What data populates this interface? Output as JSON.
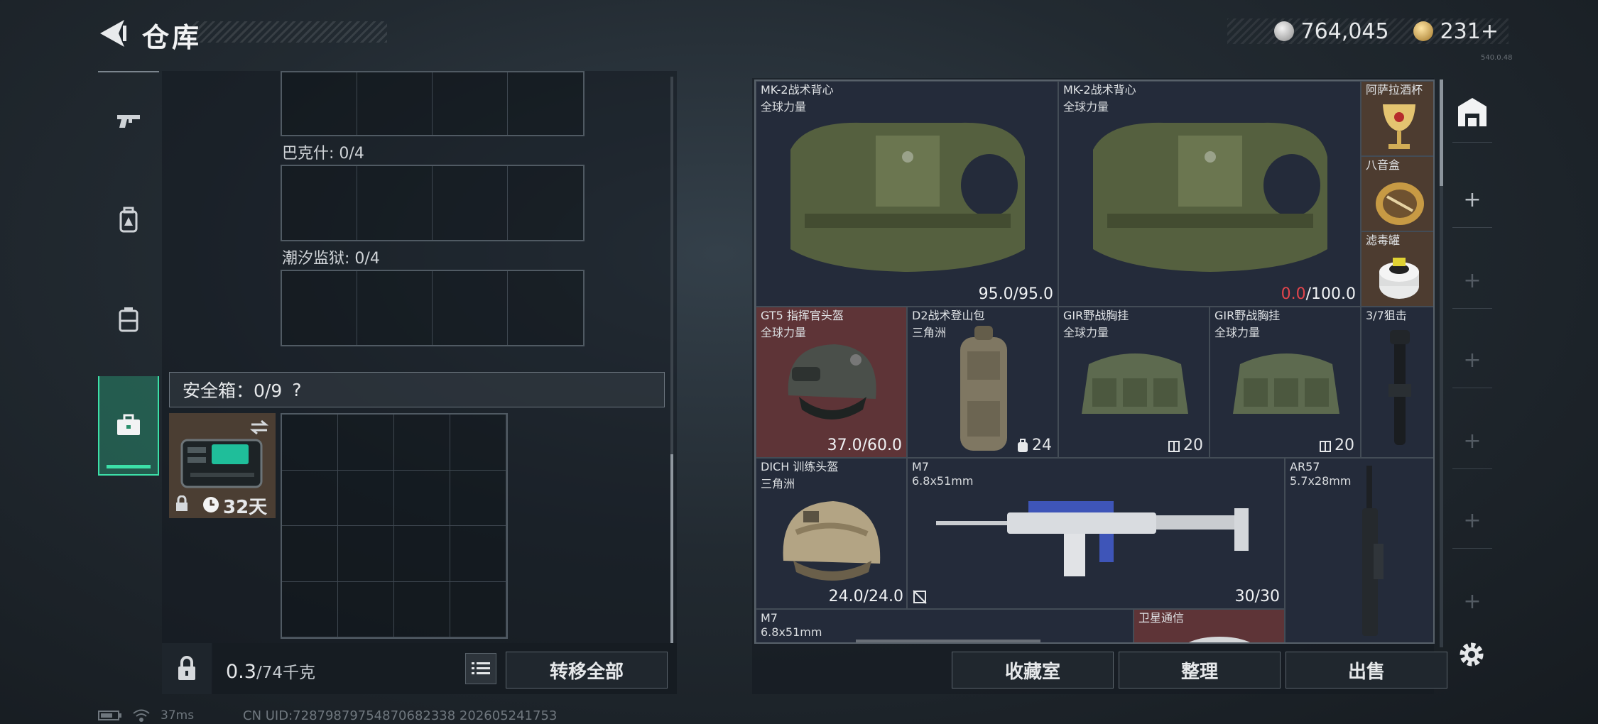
{
  "header": {
    "title": "仓库",
    "currency": {
      "silver": "764,045",
      "gold": "231+"
    },
    "version": "540.0.48"
  },
  "left_tabs": [
    {
      "id": "weapons",
      "icon": "pistol-icon"
    },
    {
      "id": "equipment",
      "icon": "backpack-icon"
    },
    {
      "id": "armor",
      "icon": "vest-icon"
    },
    {
      "id": "safe",
      "icon": "toolbox-icon",
      "active": true
    }
  ],
  "containers": [
    {
      "label": "巴克什: 0/4"
    },
    {
      "label": "潮汐监狱: 0/4"
    }
  ],
  "safe_box": {
    "label": "安全箱：0/9",
    "help": "?",
    "duration": "32天"
  },
  "weight": {
    "current": "0.3",
    "max": "/74千克"
  },
  "buttons": {
    "transfer_all": "转移全部",
    "collection": "收藏室",
    "organize": "整理",
    "sell": "出售"
  },
  "items": [
    {
      "name": "MK-2战术背心",
      "sub": "全球力量",
      "durability": "95.0",
      "max": "/95.0",
      "low": false
    },
    {
      "name": "MK-2战术背心",
      "sub": "全球力量",
      "durability": "0.0",
      "max": "/100.0",
      "low": true
    },
    {
      "name": "阿萨拉酒杯"
    },
    {
      "name": "八音盒"
    },
    {
      "name": "滤毒罐"
    },
    {
      "name": "GT5 指挥官头盔",
      "sub": "全球力量",
      "durability": "37.0",
      "max": "/60.0"
    },
    {
      "name": "D2战术登山包",
      "sub": "三角洲",
      "capacity": "24"
    },
    {
      "name": "GIR野战胸挂",
      "sub": "全球力量",
      "capacity": "20"
    },
    {
      "name": "GIR野战胸挂",
      "sub": "全球力量",
      "capacity": "20"
    },
    {
      "name": "3/7狙击"
    },
    {
      "name": "DICH 训练头盔",
      "sub": "三角洲",
      "durability": "24.0",
      "max": "/24.0"
    },
    {
      "name": "M7",
      "sub": "6.8x51mm",
      "ammo": "30/30"
    },
    {
      "name": "AR57",
      "sub": "5.7x28mm"
    },
    {
      "name": "M7",
      "sub": "6.8x51mm"
    },
    {
      "name": "卫星通信"
    }
  ],
  "status": {
    "ping": "37ms",
    "uid": "CN UID:72879879754870682338  202605241753"
  }
}
